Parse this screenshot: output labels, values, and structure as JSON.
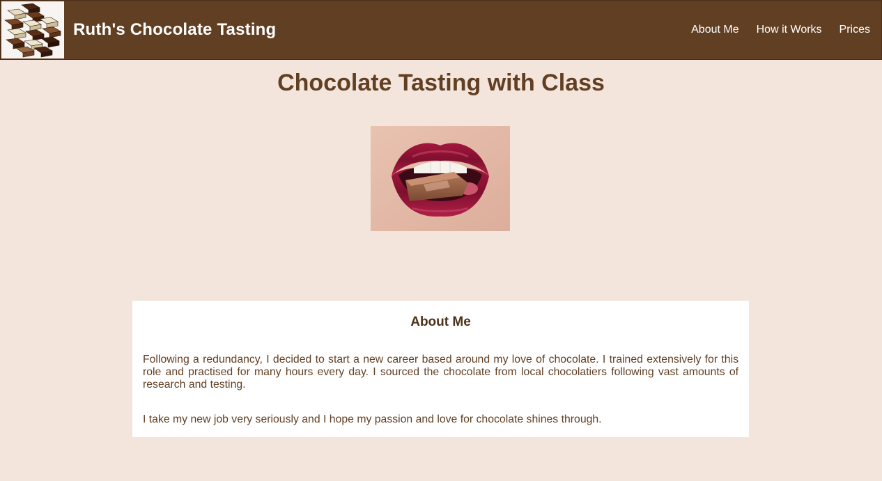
{
  "header": {
    "site_title": "Ruth's Chocolate Tasting",
    "logo_icon": "chocolate-stack-logo",
    "nav": [
      {
        "label": "About Me"
      },
      {
        "label": "How it Works"
      },
      {
        "label": "Prices"
      }
    ]
  },
  "main": {
    "title": "Chocolate Tasting with Class",
    "hero_image": "lips-biting-chocolate-photo"
  },
  "about": {
    "heading": "About Me",
    "paragraph1": "Following a redundancy, I decided to start a new career based around my love of chocolate. I trained extensively for this role and practised for many hours every day. I sourced the chocolate from local chocolatiers following vast amounts of research and testing.",
    "paragraph2": "I take my new job very seriously and I hope my passion and love for chocolate shines through."
  },
  "colors": {
    "header_bg": "#613f23",
    "page_bg": "#f3e5db",
    "text_brown": "#613f23",
    "box_bg": "#ffffff"
  }
}
